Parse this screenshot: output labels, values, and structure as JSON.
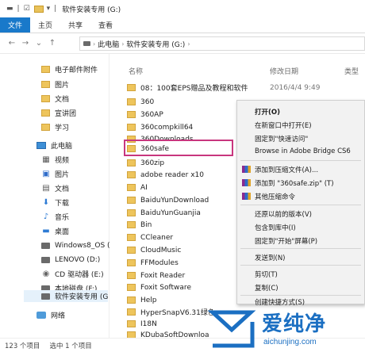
{
  "window": {
    "title": "软件安装专用 (G:)"
  },
  "ribbon": {
    "tabs": [
      "文件",
      "主页",
      "共享",
      "查看"
    ]
  },
  "address": {
    "crumbs": [
      "此电脑",
      "软件安装专用 (G:)"
    ]
  },
  "sidebar": {
    "items": [
      {
        "label": "电子邮件附件",
        "icon": "folder-icon"
      },
      {
        "label": "图片",
        "icon": "folder-icon"
      },
      {
        "label": "文档",
        "icon": "folder-icon"
      },
      {
        "label": "宣讲团",
        "icon": "folder-icon"
      },
      {
        "label": "学习",
        "icon": "folder-icon"
      },
      {
        "label": "此电脑",
        "icon": "computer-icon"
      },
      {
        "label": "视频",
        "icon": "video-icon"
      },
      {
        "label": "图片",
        "icon": "pictures-icon"
      },
      {
        "label": "文档",
        "icon": "documents-icon"
      },
      {
        "label": "下载",
        "icon": "download-icon"
      },
      {
        "label": "音乐",
        "icon": "music-icon"
      },
      {
        "label": "桌面",
        "icon": "desktop-icon"
      },
      {
        "label": "Windows8_OS (",
        "icon": "drive-icon"
      },
      {
        "label": "LENOVO (D:)",
        "icon": "drive-icon"
      },
      {
        "label": "CD 驱动器 (E:)",
        "icon": "cd-drive-icon"
      },
      {
        "label": "本地磁盘 (F:)",
        "icon": "drive-icon"
      },
      {
        "label": "软件安装专用 (G",
        "icon": "drive-icon"
      },
      {
        "label": "网络",
        "icon": "network-icon"
      }
    ]
  },
  "filelist": {
    "columns": {
      "name": "名称",
      "date": "修改日期",
      "type": "类型"
    },
    "rows": [
      {
        "name": "08：100套EPS赠品及教程和软件",
        "date": "2016/4/4 9:49"
      },
      {
        "name": "360",
        "date": ""
      },
      {
        "name": "360AP",
        "date": ""
      },
      {
        "name": "360compkill64",
        "date": ""
      },
      {
        "name": "360Downloads",
        "date": ""
      },
      {
        "name": "360safe",
        "date": ""
      },
      {
        "name": "360zip",
        "date": ""
      },
      {
        "name": "adobe reader x10",
        "date": ""
      },
      {
        "name": "AI",
        "date": ""
      },
      {
        "name": "BaiduYunDownload",
        "date": ""
      },
      {
        "name": "BaiduYunGuanjia",
        "date": ""
      },
      {
        "name": "Bin",
        "date": ""
      },
      {
        "name": "CCleaner",
        "date": ""
      },
      {
        "name": "CloudMusic",
        "date": ""
      },
      {
        "name": "FFModules",
        "date": ""
      },
      {
        "name": "Foxit Reader",
        "date": ""
      },
      {
        "name": "Foxit Software",
        "date": ""
      },
      {
        "name": "Help",
        "date": ""
      },
      {
        "name": "HyperSnapV6.31绿色",
        "date": ""
      },
      {
        "name": "I18N",
        "date": ""
      },
      {
        "name": "KDubaSoftDownloa",
        "date": ""
      }
    ]
  },
  "context_menu": {
    "items": [
      {
        "label": "打开(O)",
        "bold": true
      },
      {
        "label": "在新窗口中打开(E)"
      },
      {
        "label": "固定到\"快速访问\""
      },
      {
        "label": "Browse in Adobe Bridge CS6"
      },
      {
        "label": "添加到压缩文件(A)...",
        "icon": "winrar-icon"
      },
      {
        "label": "添加到 \"360safe.zip\" (T)",
        "icon": "winrar-icon"
      },
      {
        "label": "其他压缩命令",
        "icon": "winrar-icon"
      },
      {
        "label": "还原以前的版本(V)"
      },
      {
        "label": "包含到库中(I)"
      },
      {
        "label": "固定到\"开始\"屏幕(P)"
      },
      {
        "label": "发送到(N)"
      },
      {
        "label": "剪切(T)"
      },
      {
        "label": "复制(C)"
      },
      {
        "label": "创建快捷方式(S)"
      }
    ]
  },
  "status": {
    "count": "123 个项目",
    "selected": "选中 1 个项目"
  },
  "watermark": {
    "cn": "爱纯净",
    "url": "aichunjing.com"
  },
  "colors": {
    "accent": "#1979ca",
    "highlight_border": "#c8367e",
    "watermark": "#1b6fc2"
  }
}
